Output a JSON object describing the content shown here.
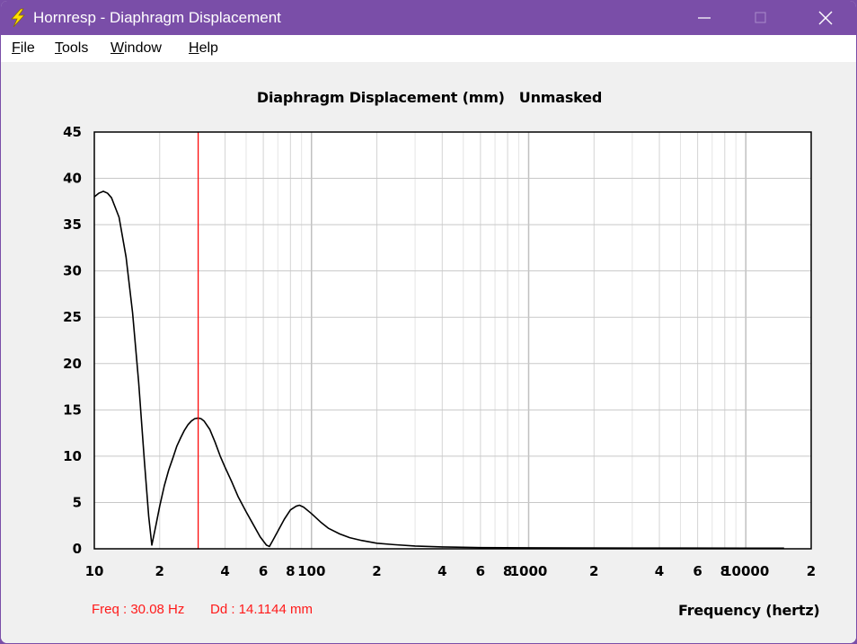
{
  "window": {
    "title": "Hornresp - Diaphragm Displacement",
    "icon": "lightning-bolt-icon",
    "controls": [
      "minimize-icon",
      "maximize-icon",
      "close-icon"
    ],
    "accent": "#7a4ea8"
  },
  "menu": {
    "file": {
      "accel": "F",
      "rest": "ile"
    },
    "tools": {
      "accel": "T",
      "rest": "ools"
    },
    "window": {
      "accel": "W",
      "rest": "indow"
    },
    "help": {
      "accel": "H",
      "rest": "elp"
    }
  },
  "status": {
    "freq": "Freq : 30.08 Hz",
    "dd": "Dd : 14.1144 mm"
  },
  "chart_data": {
    "type": "line",
    "title": "Diaphragm Displacement (mm)",
    "mask_state": "Unmasked",
    "xlabel": "Frequency (hertz)",
    "ylabel": "",
    "xscale": "log",
    "xlim": [
      10,
      20000
    ],
    "ylim": [
      0,
      45
    ],
    "grid": true,
    "y_ticks": [
      0,
      5,
      10,
      15,
      20,
      25,
      30,
      35,
      40,
      45
    ],
    "x_tick_labels": [
      {
        "x": 10,
        "label": "10"
      },
      {
        "x": 20,
        "label": "2"
      },
      {
        "x": 40,
        "label": "4"
      },
      {
        "x": 60,
        "label": "6"
      },
      {
        "x": 80,
        "label": "8"
      },
      {
        "x": 100,
        "label": "100"
      },
      {
        "x": 200,
        "label": "2"
      },
      {
        "x": 400,
        "label": "4"
      },
      {
        "x": 600,
        "label": "6"
      },
      {
        "x": 800,
        "label": "8"
      },
      {
        "x": 1000,
        "label": "1000"
      },
      {
        "x": 2000,
        "label": "2"
      },
      {
        "x": 4000,
        "label": "4"
      },
      {
        "x": 6000,
        "label": "6"
      },
      {
        "x": 8000,
        "label": "8"
      },
      {
        "x": 10000,
        "label": "10000"
      },
      {
        "x": 20000,
        "label": "2"
      }
    ],
    "cursor": {
      "x": 30.08,
      "y": 14.1144,
      "color": "#ff0000"
    },
    "series": [
      {
        "color": "#000000",
        "points": [
          [
            10,
            38
          ],
          [
            10.5,
            38.4
          ],
          [
            11,
            38.6
          ],
          [
            11.5,
            38.4
          ],
          [
            12,
            37.9
          ],
          [
            13,
            35.8
          ],
          [
            14,
            31.5
          ],
          [
            15,
            25.5
          ],
          [
            16,
            18
          ],
          [
            17,
            9.5
          ],
          [
            17.8,
            3.5
          ],
          [
            18.4,
            0.4
          ],
          [
            19.2,
            2.5
          ],
          [
            20,
            4.6
          ],
          [
            21,
            6.8
          ],
          [
            22,
            8.5
          ],
          [
            23,
            9.8
          ],
          [
            24,
            11.1
          ],
          [
            25,
            12
          ],
          [
            26,
            12.8
          ],
          [
            27,
            13.4
          ],
          [
            28,
            13.8
          ],
          [
            29,
            14.05
          ],
          [
            30.08,
            14.1144
          ],
          [
            31,
            14.05
          ],
          [
            32,
            13.8
          ],
          [
            34,
            12.9
          ],
          [
            36,
            11.5
          ],
          [
            38,
            10
          ],
          [
            40,
            8.8
          ],
          [
            43,
            7.2
          ],
          [
            46,
            5.6
          ],
          [
            50,
            4
          ],
          [
            54,
            2.6
          ],
          [
            58,
            1.3
          ],
          [
            62,
            0.4
          ],
          [
            64,
            0.25
          ],
          [
            66,
            0.8
          ],
          [
            70,
            1.9
          ],
          [
            75,
            3.2
          ],
          [
            80,
            4.2
          ],
          [
            85,
            4.6
          ],
          [
            88,
            4.7
          ],
          [
            92,
            4.5
          ],
          [
            100,
            3.8
          ],
          [
            110,
            2.9
          ],
          [
            120,
            2.2
          ],
          [
            135,
            1.6
          ],
          [
            150,
            1.2
          ],
          [
            170,
            0.9
          ],
          [
            200,
            0.6
          ],
          [
            240,
            0.45
          ],
          [
            300,
            0.3
          ],
          [
            400,
            0.2
          ],
          [
            600,
            0.13
          ],
          [
            1000,
            0.1
          ],
          [
            3000,
            0.08
          ],
          [
            10000,
            0.07
          ],
          [
            15000,
            0.07
          ]
        ]
      }
    ]
  }
}
